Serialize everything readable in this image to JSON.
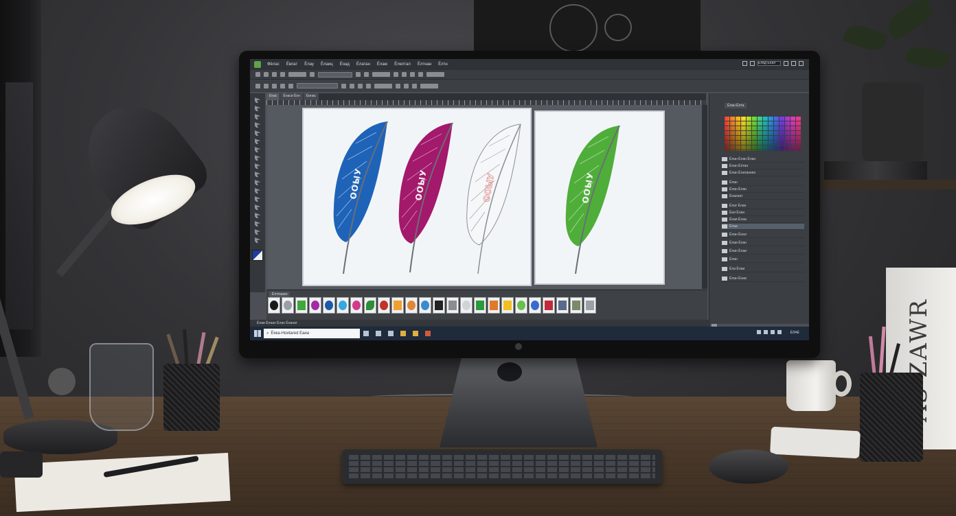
{
  "photo": {
    "book_spine": "AS ZAWR"
  },
  "app": {
    "menu": [
      "Фёлас",
      "Ёвлат",
      "Ёлау",
      "Ёлаиц",
      "Ёоад",
      "Ёлатан",
      "Ёлаю",
      "Ёлелтал",
      "Ёлтнан",
      "Ёлтн"
    ],
    "status_field": "Ёлад Ёнал",
    "tabs": [
      "Ёнас",
      "Ёнаси Ёон",
      "Ёинас"
    ],
    "swatches_tab": "Ёлан Ёлта",
    "panel_rows": [
      "Ёлан Ёлан Ёлан",
      "Ёлан Ёлтан",
      "Ёлан Ёлатаннее",
      "Ёлан",
      "Ёлан Ёлан",
      "Ёнаннат",
      "Ёлат Ёлан",
      "Ёал Ёлан",
      "Ёнаи Ёлаа",
      "Ёлаа",
      "Ёлан Ёнал",
      "Ёлаи Ёлан",
      "Ёлан Ёлаи",
      "Ёлан",
      "Ёла Ёлаи",
      "Ёлан Ёнаи"
    ],
    "highlighted_row": 5,
    "brushes_tab": "Ёлтлааан",
    "status_text": "Ёлаи Ёлаан Ёлан Ёнанат",
    "feather_labels": [
      "ООЫУ",
      "ООЫУ",
      "ООЫУ",
      "ООЫУ"
    ],
    "colors": {
      "blue": "#1e63b8",
      "magenta": "#a3196b",
      "outline": "#8a8f96",
      "green": "#4fae3a"
    }
  },
  "taskbar": {
    "search": "Ёяка-Ноиtаrеd Еаиа",
    "clock": "ЁЛАЁ"
  }
}
